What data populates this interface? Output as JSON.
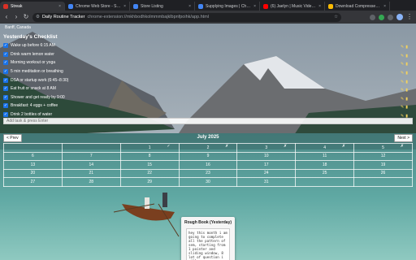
{
  "browser": {
    "tabs": [
      {
        "label": "Streak",
        "color": "#d93025",
        "active": true
      },
      {
        "label": "Chrome Web Store - Search Re",
        "color": "#4285f4",
        "active": false
      },
      {
        "label": "Store Listing",
        "color": "#4285f4",
        "active": false
      },
      {
        "label": "Supplying Images | Chrome",
        "color": "#4285f4",
        "active": false
      },
      {
        "label": "(6) Jaelyn | Music Video | C",
        "color": "#ff0000",
        "active": false
      },
      {
        "label": "Download Compressed JPEG",
        "color": "#fbbc04",
        "active": false
      }
    ],
    "omnibox": {
      "origin": "Daily Routine Tracker",
      "url": "chrome-extension://mkhbodhkolmmmbajklbpnfpoihk/app.html"
    }
  },
  "page": {
    "location": "Banff, Canada",
    "checklist_title": "Yesterday's Checklist",
    "checklist": [
      "Wake up before 6:15 AM",
      "Drink warm lemon water",
      "Morning workout or yoga",
      "5 min meditation or breathing",
      "DSA or startup work (6:45–8:30)",
      "Eat fruit or snack at 8 AM",
      "Shower and get ready by 9:00",
      "Breakfast: 4 eggs + coffee",
      "Drink 2 bottles of water"
    ],
    "add_placeholder": "Add task & press Enter",
    "calendar": {
      "prev_label": "< Prev",
      "next_label": "Next >",
      "title": "July 2025",
      "weeks": [
        [
          {
            "d": "",
            "m": ""
          },
          {
            "d": "",
            "m": ""
          },
          {
            "d": "1",
            "m": "✓"
          },
          {
            "d": "2",
            "m": "✗"
          },
          {
            "d": "3",
            "m": "✗"
          },
          {
            "d": "4",
            "m": "✗"
          },
          {
            "d": "5",
            "m": "✗"
          }
        ],
        [
          {
            "d": "6",
            "m": ""
          },
          {
            "d": "7",
            "m": ""
          },
          {
            "d": "8",
            "m": ""
          },
          {
            "d": "9",
            "m": ""
          },
          {
            "d": "10",
            "m": ""
          },
          {
            "d": "11",
            "m": ""
          },
          {
            "d": "12",
            "m": ""
          }
        ],
        [
          {
            "d": "13",
            "m": ""
          },
          {
            "d": "14",
            "m": ""
          },
          {
            "d": "15",
            "m": ""
          },
          {
            "d": "16",
            "m": ""
          },
          {
            "d": "17",
            "m": ""
          },
          {
            "d": "18",
            "m": ""
          },
          {
            "d": "19",
            "m": ""
          }
        ],
        [
          {
            "d": "20",
            "m": ""
          },
          {
            "d": "21",
            "m": ""
          },
          {
            "d": "22",
            "m": ""
          },
          {
            "d": "23",
            "m": ""
          },
          {
            "d": "24",
            "m": ""
          },
          {
            "d": "25",
            "m": ""
          },
          {
            "d": "26",
            "m": ""
          }
        ],
        [
          {
            "d": "27",
            "m": ""
          },
          {
            "d": "28",
            "m": ""
          },
          {
            "d": "29",
            "m": ""
          },
          {
            "d": "30",
            "m": ""
          },
          {
            "d": "31",
            "m": ""
          },
          {
            "d": "",
            "m": ""
          },
          {
            "d": "",
            "m": ""
          }
        ]
      ]
    },
    "notes_title": "Rough Book (Yesterday)",
    "notes_text": "hey this month i am going to complete all the pattern of sem, starting from 1 pointer and sliding window, 8 lot of question i will"
  }
}
